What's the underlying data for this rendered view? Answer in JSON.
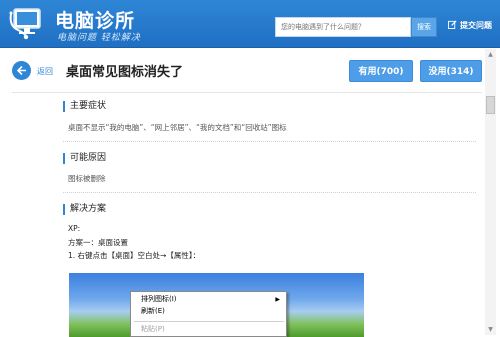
{
  "header": {
    "title": "电脑诊所",
    "slogan": "电脑问题 轻松解决",
    "search_placeholder": "您的电脑遇到了什么问题？",
    "search_button": "搜索",
    "ask_link": "提交问题"
  },
  "article": {
    "back_label": "返回",
    "title": "桌面常见图标消失了",
    "useful_button": "有用(700)",
    "useless_button": "没用(314)"
  },
  "sections": {
    "symptom_head": "主要症状",
    "symptom_text": "桌面不显示“我的电脑”、“网上邻居”、“我的文档”和“回收站”图标",
    "cause_head": "可能原因",
    "cause_text": "图标被删除",
    "solution_head": "解决方案",
    "solution_lines": [
      "XP:",
      "方案一：桌面设置",
      "1. 右键点击【桌面】空白处→【属性】："
    ]
  },
  "context_menu": {
    "item1": "排列图标(I)",
    "item2": "刷新(E)",
    "item3": "粘贴(P)"
  },
  "icons": {
    "logo": "stethoscope-monitor-icon",
    "ask": "edit-icon",
    "back": "back-arrow-icon",
    "scroll_up": "scroll-up-arrow",
    "scroll_down": "scroll-down-arrow",
    "submenu": "submenu-arrow-icon"
  },
  "colors": {
    "brand": "#2f86d6",
    "button": "#4d9de8"
  }
}
